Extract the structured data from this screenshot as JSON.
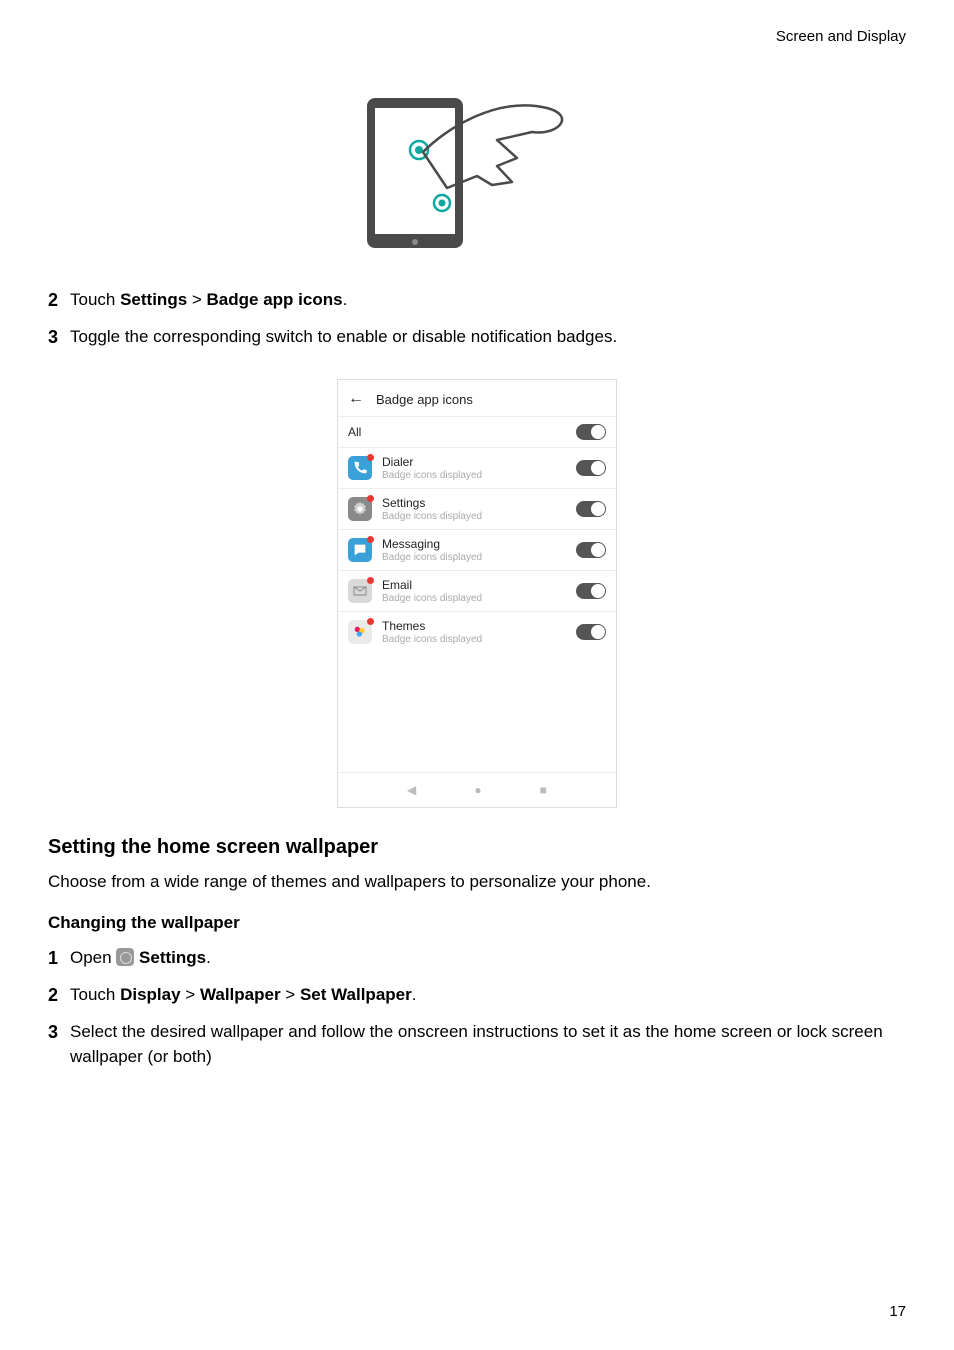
{
  "header": {
    "right": "Screen and Display"
  },
  "steps_a": [
    {
      "num": "2",
      "parts": [
        "Touch ",
        {
          "b": "Settings"
        },
        " > ",
        {
          "b": "Badge app icons"
        },
        "."
      ]
    },
    {
      "num": "3",
      "parts": [
        "Toggle the corresponding switch to enable or disable notification badges."
      ]
    }
  ],
  "screenshot": {
    "title": "Badge app icons",
    "all_label": "All",
    "items": [
      {
        "name": "Dialer",
        "sub": "Badge icons displayed",
        "color": "#3aa0d8",
        "glyph": "phone"
      },
      {
        "name": "Settings",
        "sub": "Badge icons displayed",
        "color": "#8a8a8a",
        "glyph": "gear"
      },
      {
        "name": "Messaging",
        "sub": "Badge icons displayed",
        "color": "#3aa0d8",
        "glyph": "chat"
      },
      {
        "name": "Email",
        "sub": "Badge icons displayed",
        "color": "#d9d9d9",
        "glyph": "mail"
      },
      {
        "name": "Themes",
        "sub": "Badge icons displayed",
        "color": "#eaeaea",
        "glyph": "theme"
      }
    ]
  },
  "section": {
    "heading": "Setting the home screen wallpaper",
    "intro": "Choose from a wide range of themes and wallpapers to personalize your phone.",
    "subheading": "Changing the wallpaper"
  },
  "steps_b": [
    {
      "num": "1",
      "parts": [
        "Open ",
        {
          "icon": true
        },
        " ",
        {
          "b": "Settings"
        },
        "."
      ]
    },
    {
      "num": "2",
      "parts": [
        "Touch ",
        {
          "b": "Display"
        },
        " > ",
        {
          "b": "Wallpaper"
        },
        " > ",
        {
          "b": "Set Wallpaper"
        },
        "."
      ]
    },
    {
      "num": "3",
      "parts": [
        "Select the desired wallpaper and follow the onscreen instructions to set it as the home screen or lock screen wallpaper (or both)"
      ]
    }
  ],
  "page_number": "17"
}
